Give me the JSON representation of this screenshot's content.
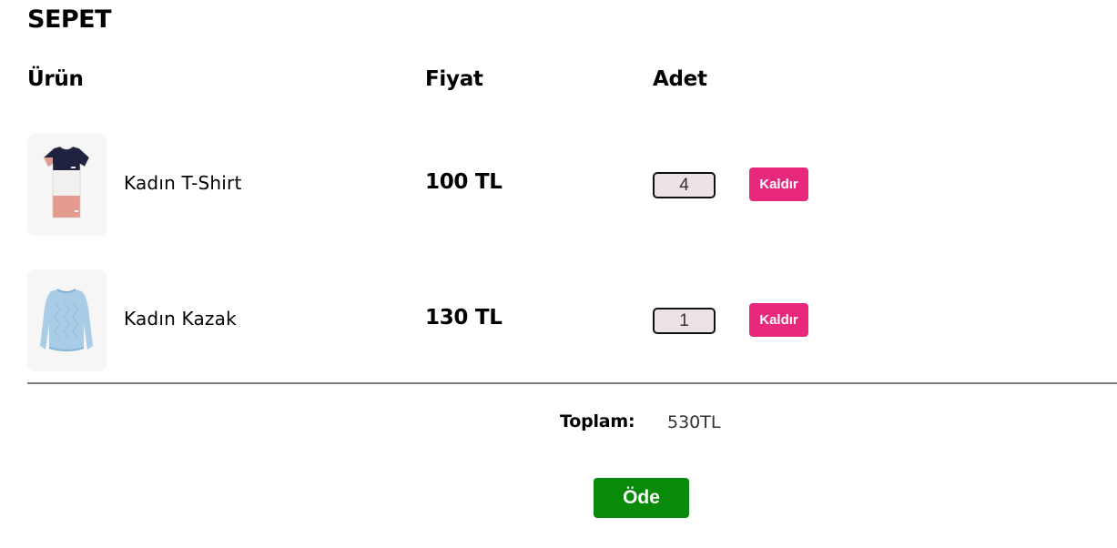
{
  "cart": {
    "title": "SEPET",
    "headers": {
      "product": "Ürün",
      "price": "Fiyat",
      "quantity": "Adet"
    },
    "items": [
      {
        "name": "Kadın T-Shirt",
        "price": "100 TL",
        "quantity": "4",
        "remove_label": "Kaldır",
        "image_icon": "tshirt-icon"
      },
      {
        "name": "Kadın Kazak",
        "price": "130 TL",
        "quantity": "1",
        "remove_label": "Kaldır",
        "image_icon": "sweater-icon"
      }
    ],
    "total_label": "Toplam:",
    "total_value": "530TL",
    "pay_label": "Öde"
  },
  "colors": {
    "remove_button": "#e8287a",
    "pay_button": "#0a8a0a",
    "quantity_field": "#ece3e5"
  }
}
